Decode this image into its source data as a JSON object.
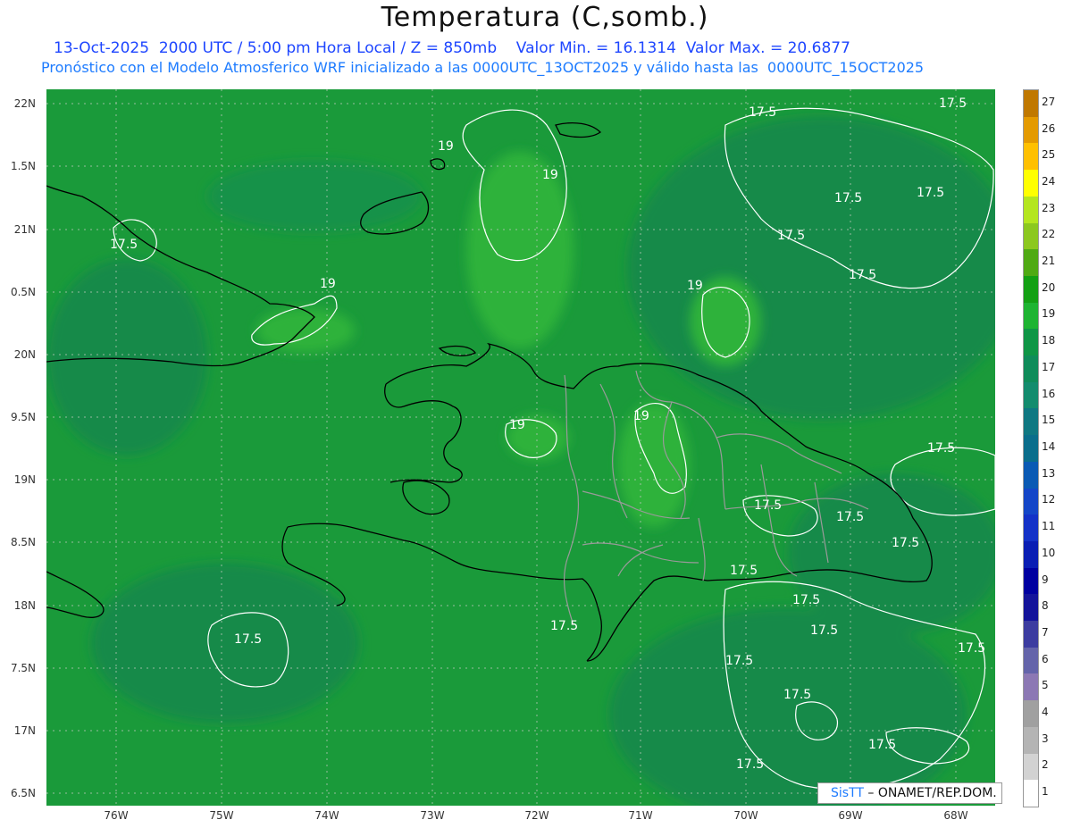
{
  "title": "Temperatura (C,somb.)",
  "line1": "13-Oct-2025  2000 UTC / 5:00 pm Hora Local / Z = 850mb    Valor Min. = 16.1314  Valor Max. = 20.6877",
  "line2": "Pronóstico con el Modelo Atmosferico WRF inicializado a las 0000UTC_13OCT2025 y válido hasta las  0000UTC_15OCT2025",
  "ytick_labels": [
    "22N",
    "1.5N",
    "21N",
    "0.5N",
    "20N",
    "9.5N",
    "19N",
    "8.5N",
    "18N",
    "7.5N",
    "17N",
    "6.5N"
  ],
  "xtick_labels": [
    "76W",
    "75W",
    "74W",
    "73W",
    "72W",
    "71W",
    "70W",
    "69W",
    "68W"
  ],
  "contour_labels": [
    "19",
    "19",
    "19",
    "19",
    "19",
    "19",
    "17.5",
    "17.5",
    "17.5",
    "17.5",
    "17.5",
    "17.5",
    "17.5",
    "17.5",
    "17.5",
    "17.5",
    "17.5",
    "17.5",
    "17.5",
    "17.5",
    "17.5",
    "17.5",
    "17.5",
    "17.5",
    "17.5",
    "17.5",
    "17.5"
  ],
  "colorbar": {
    "labels": [
      "27",
      "26",
      "25",
      "24",
      "23",
      "22",
      "21",
      "20",
      "19",
      "18",
      "17",
      "16",
      "15",
      "14",
      "13",
      "12",
      "11",
      "10",
      "9",
      "8",
      "7",
      "6",
      "5",
      "4",
      "3",
      "2",
      "1"
    ],
    "colors": [
      "#c07800",
      "#e49a00",
      "#ffc000",
      "#ffff00",
      "#b4e61e",
      "#8cc81e",
      "#50aa14",
      "#14a014",
      "#1eb432",
      "#0f9646",
      "#0f8c5a",
      "#138c6e",
      "#0f7882",
      "#0a6e8c",
      "#0a5ab4",
      "#1446c8",
      "#1432c8",
      "#0a1eb4",
      "#0000a0",
      "#14149b",
      "#3c3ca0",
      "#6464aa",
      "#8c78b4",
      "#a0a0a0",
      "#b4b4b4",
      "#d2d2d2",
      "#ffffff"
    ]
  },
  "logo": {
    "sis": "SisTT",
    "rest": "– ONAMET/REP.DOM."
  }
}
